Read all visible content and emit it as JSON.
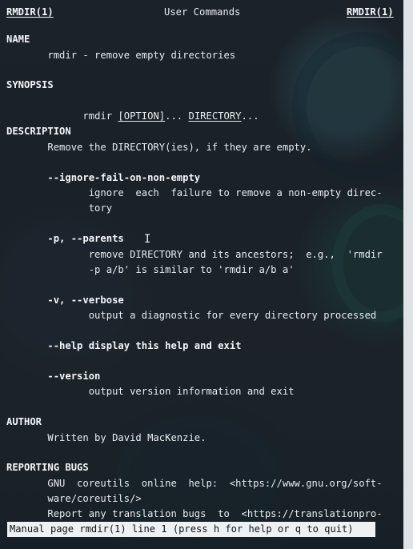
{
  "header": {
    "left": "RMDIR(1)",
    "center": "User Commands",
    "right": "RMDIR(1)"
  },
  "sections": {
    "name_heading": "NAME",
    "name_text": "       rmdir - remove empty directories",
    "synopsis_heading": "SYNOPSIS",
    "synopsis_prefix": "       rmdir ",
    "synopsis_option": "[OPTION]",
    "synopsis_middle": "... ",
    "synopsis_directory": "DIRECTORY",
    "synopsis_suffix": "...",
    "description_heading": "DESCRIPTION",
    "description_text": "       Remove the DIRECTORY(ies), if they are empty.",
    "opt1_name": "       --ignore-fail-on-non-empty",
    "opt1_line1": "              ignore  each  failure to remove a non-empty direc-",
    "opt1_line2": "              tory",
    "opt2_name": "       -p, --parents",
    "opt2_line1": "              remove DIRECTORY and its ancestors;  e.g.,  'rmdir",
    "opt2_line2": "              -p a/b' is similar to 'rmdir a/b a'",
    "opt3_name": "       -v, --verbose",
    "opt3_line1": "              output a diagnostic for every directory processed",
    "help_line": "       --help display this help and exit",
    "version_name": "       --version",
    "version_line1": "              output version information and exit",
    "author_heading": "AUTHOR",
    "author_text": "       Written by David MacKenzie.",
    "bugs_heading": "REPORTING BUGS",
    "bugs_line1": "       GNU  coreutils  online  help:  <https://www.gnu.org/soft-",
    "bugs_line2": "       ware/coreutils/>",
    "bugs_line3": "       Report any translation bugs  to  <https://translationpro-"
  },
  "status": {
    "text": "Manual page rmdir(1) line 1 (press h for help or q to quit)"
  },
  "cursor": {
    "glyph": "I"
  }
}
